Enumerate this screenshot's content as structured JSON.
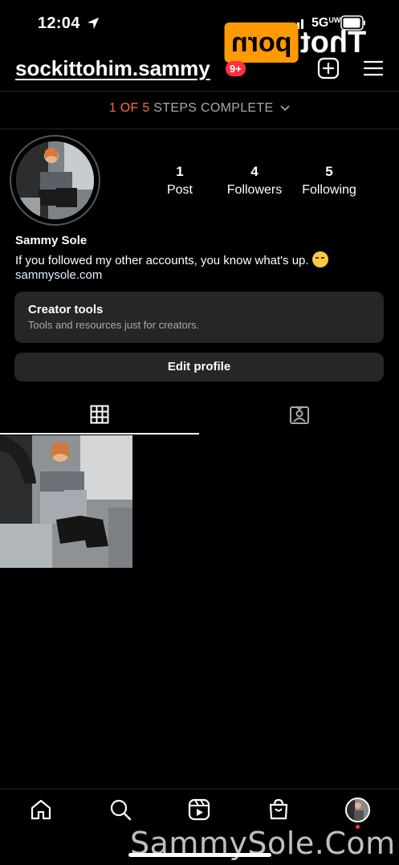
{
  "status_bar": {
    "time": "12:04",
    "network": "5G",
    "network_sub": "UW"
  },
  "watermark": {
    "logo_box": "porn",
    "logo_text": "Thot",
    "bottom_text": "SammySole.Com"
  },
  "header": {
    "username": "sockittohim.sammy",
    "notification_badge": "9+"
  },
  "onboarding": {
    "steps_done": "1 OF 5",
    "steps_label": "STEPS COMPLETE"
  },
  "stats": {
    "posts": {
      "count": "1",
      "label": "Post"
    },
    "followers": {
      "count": "4",
      "label": "Followers"
    },
    "following": {
      "count": "5",
      "label": "Following"
    }
  },
  "profile": {
    "name": "Sammy Sole",
    "bio": "If you followed my other accounts, you know what's up.",
    "bio_emoji": "smirking-face",
    "link": "sammysole.com"
  },
  "creator_tools": {
    "title": "Creator tools",
    "subtitle": "Tools and resources just for creators."
  },
  "actions": {
    "edit_profile": "Edit profile"
  },
  "tabs": [
    {
      "name": "grid",
      "icon": "grid-icon",
      "active": true
    },
    {
      "name": "tagged",
      "icon": "tagged-icon",
      "active": false
    }
  ],
  "bottom_nav": [
    {
      "icon": "home-icon"
    },
    {
      "icon": "search-icon"
    },
    {
      "icon": "reels-icon"
    },
    {
      "icon": "shop-icon"
    },
    {
      "icon": "profile-avatar"
    }
  ],
  "colors": {
    "accent_steps": "#ff6a3d",
    "badge": "#ff3040",
    "card_bg": "#262626"
  }
}
